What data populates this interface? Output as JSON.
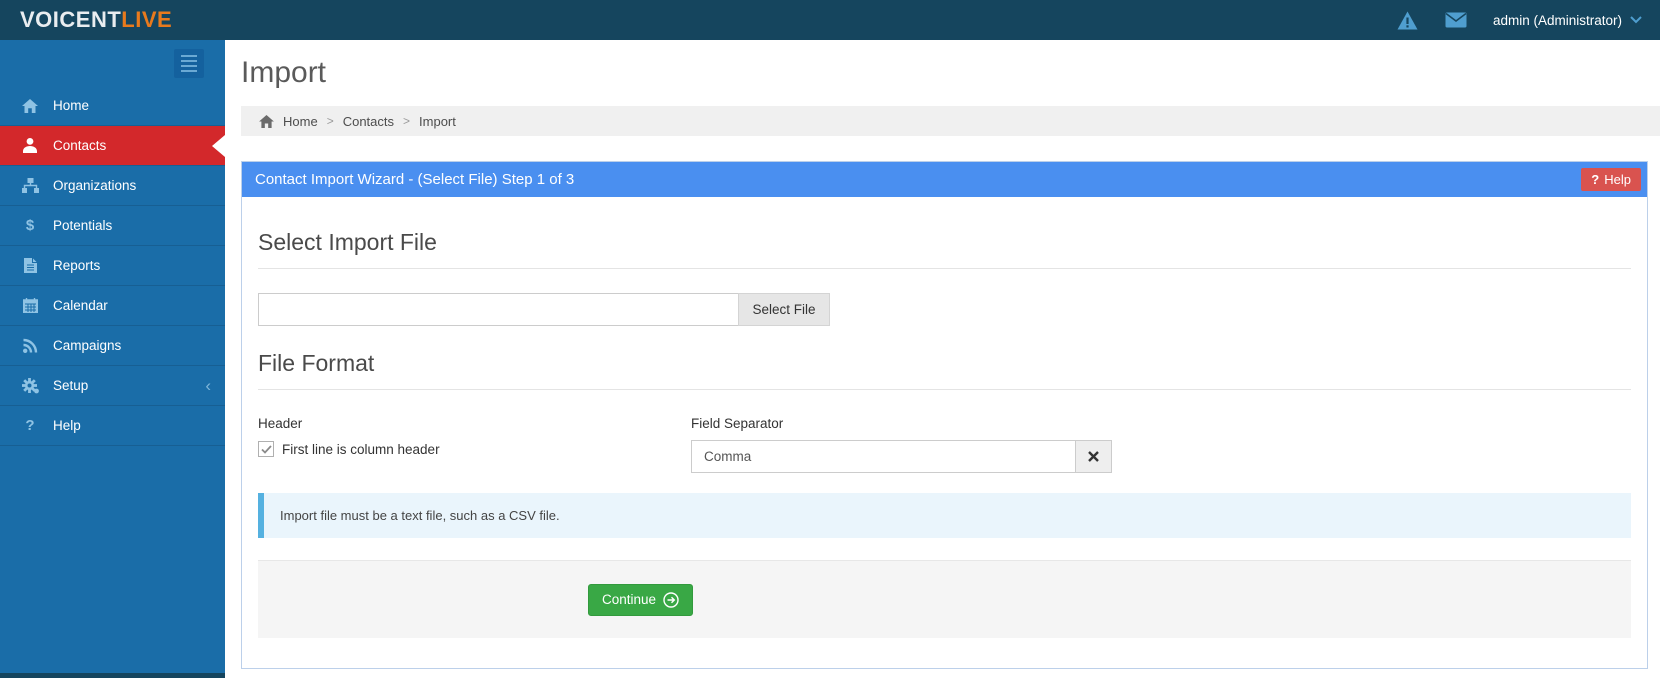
{
  "colors": {
    "navbar_bg": "#15455e",
    "sidebar_bg": "#1a6da8",
    "active_item_bg": "#d3282b",
    "panel_header_bg": "#4a8ff0",
    "help_button_bg": "#d9534f",
    "continue_button_bg": "#39a845",
    "alert_bg": "#eaf5fc",
    "alert_stripe": "#55b1e0",
    "logo_accent": "#e87a1d"
  },
  "navbar": {
    "logo_primary": "VOICENT",
    "logo_accent": "LIVE",
    "icons": [
      "warning-icon",
      "envelope-icon",
      "chevron-down-icon"
    ],
    "user_menu_label": "admin (Administrator)"
  },
  "sidebar": {
    "items": [
      {
        "label": "Home",
        "icon": "home-icon",
        "active": false
      },
      {
        "label": "Contacts",
        "icon": "user-icon",
        "active": true
      },
      {
        "label": "Organizations",
        "icon": "sitemap-icon",
        "active": false
      },
      {
        "label": "Potentials",
        "icon": "dollar-icon",
        "active": false
      },
      {
        "label": "Reports",
        "icon": "file-icon",
        "active": false
      },
      {
        "label": "Calendar",
        "icon": "calendar-icon",
        "active": false
      },
      {
        "label": "Campaigns",
        "icon": "rss-icon",
        "active": false
      },
      {
        "label": "Setup",
        "icon": "gears-icon",
        "active": false,
        "has_submenu": true,
        "chevron": "‹"
      },
      {
        "label": "Help",
        "icon": "question-icon",
        "active": false
      }
    ]
  },
  "page": {
    "title": "Import",
    "breadcrumb": [
      "Home",
      "Contacts",
      "Import"
    ],
    "breadcrumb_separator": ">"
  },
  "wizard": {
    "title": "Contact Import Wizard - (Select File) Step 1 of 3",
    "help_label": "Help",
    "help_icon_glyph": "?",
    "select_file": {
      "heading": "Select Import File",
      "input_value": "",
      "button_label": "Select File"
    },
    "file_format": {
      "heading": "File Format",
      "header_label": "Header",
      "checkbox_label": "First line is column header",
      "checkbox_checked": true,
      "separator_label": "Field Separator",
      "separator_value": "Comma"
    },
    "note": "Import file must be a text file, such as a CSV file.",
    "continue_label": "Continue"
  }
}
